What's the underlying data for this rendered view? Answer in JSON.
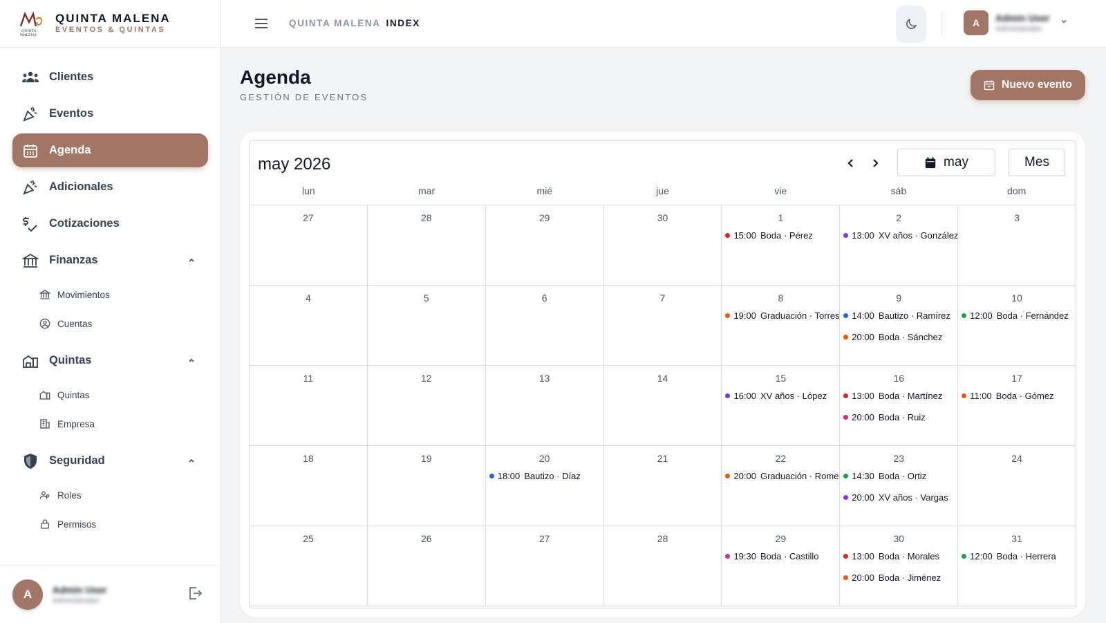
{
  "brand": {
    "title": "QUINTA MALENA",
    "subtitle": "EVENTOS & QUINTAS",
    "logo_text": "QUINTA MALENA"
  },
  "colors": {
    "accent": "#a27667",
    "event_red": "#dc2626",
    "event_purple": "#7c3aed",
    "event_orange": "#ea580c",
    "event_blue": "#2563eb",
    "event_green": "#16a34a",
    "event_pink": "#db2777"
  },
  "sidebar": {
    "items": [
      {
        "label": "Clientes",
        "icon": "users-icon"
      },
      {
        "label": "Eventos",
        "icon": "party-popper-icon"
      },
      {
        "label": "Agenda",
        "icon": "calendar-icon",
        "active": true
      },
      {
        "label": "Adicionales",
        "icon": "party-popper-icon"
      },
      {
        "label": "Cotizaciones",
        "icon": "money-check-icon"
      },
      {
        "label": "Finanzas",
        "icon": "bank-icon",
        "expanded": true
      },
      {
        "label": "Movimientos",
        "icon": "bank-small-icon"
      },
      {
        "label": "Cuentas",
        "icon": "user-circle-icon"
      },
      {
        "label": "Quintas",
        "icon": "buildings-icon",
        "expanded": true
      },
      {
        "label": "Quintas",
        "icon": "buildings-small-icon"
      },
      {
        "label": "Empresa",
        "icon": "office-icon"
      },
      {
        "label": "Seguridad",
        "icon": "shield-icon",
        "expanded": true
      },
      {
        "label": "Roles",
        "icon": "user-group-icon"
      },
      {
        "label": "Permisos",
        "icon": "lock-icon"
      }
    ]
  },
  "user": {
    "initial": "A",
    "name": "Admin User",
    "role": "Administrador"
  },
  "topbar": {
    "crumb_app": "QUINTA MALENA",
    "crumb_page": "INDEX"
  },
  "page": {
    "title": "Agenda",
    "subtitle": "GESTIÓN DE EVENTOS",
    "new_button": "Nuevo evento"
  },
  "calendar": {
    "title": "may 2026",
    "month_button": "may",
    "view_button": "Mes",
    "weekdays": [
      "lun",
      "mar",
      "mié",
      "jue",
      "vie",
      "sáb",
      "dom"
    ],
    "weeks": [
      [
        {
          "n": "27",
          "ev": []
        },
        {
          "n": "28",
          "ev": []
        },
        {
          "n": "29",
          "ev": []
        },
        {
          "n": "30",
          "ev": []
        },
        {
          "n": "1",
          "ev": [
            {
              "t": "15:00",
              "d": "Boda · Pérez",
              "c": "#dc2626"
            }
          ]
        },
        {
          "n": "2",
          "ev": [
            {
              "t": "13:00",
              "d": "XV años · González",
              "c": "#7c3aed"
            }
          ]
        },
        {
          "n": "3",
          "ev": []
        }
      ],
      [
        {
          "n": "4",
          "ev": []
        },
        {
          "n": "5",
          "ev": []
        },
        {
          "n": "6",
          "ev": []
        },
        {
          "n": "7",
          "ev": []
        },
        {
          "n": "8",
          "ev": [
            {
              "t": "19:00",
              "d": "Graduación · Torres",
              "c": "#ea580c"
            }
          ]
        },
        {
          "n": "9",
          "ev": [
            {
              "t": "14:00",
              "d": "Bautizo · Ramírez",
              "c": "#2563eb"
            },
            {
              "t": "20:00",
              "d": "Boda · Sánchez",
              "c": "#ea580c"
            }
          ]
        },
        {
          "n": "10",
          "ev": [
            {
              "t": "12:00",
              "d": "Boda · Fernández",
              "c": "#16a34a"
            }
          ]
        }
      ],
      [
        {
          "n": "11",
          "ev": []
        },
        {
          "n": "12",
          "ev": []
        },
        {
          "n": "13",
          "ev": []
        },
        {
          "n": "14",
          "ev": []
        },
        {
          "n": "15",
          "ev": [
            {
              "t": "16:00",
              "d": "XV años · López",
              "c": "#7c3aed"
            }
          ]
        },
        {
          "n": "16",
          "ev": [
            {
              "t": "13:00",
              "d": "Boda · Martínez",
              "c": "#dc2626"
            },
            {
              "t": "20:00",
              "d": "Boda · Ruiz",
              "c": "#db2777"
            }
          ]
        },
        {
          "n": "17",
          "ev": [
            {
              "t": "11:00",
              "d": "Boda · Gómez",
              "c": "#ea580c"
            }
          ]
        }
      ],
      [
        {
          "n": "18",
          "ev": []
        },
        {
          "n": "19",
          "ev": []
        },
        {
          "n": "20",
          "ev": [
            {
              "t": "18:00",
              "d": "Bautizo · Díaz",
              "c": "#2563eb"
            }
          ]
        },
        {
          "n": "21",
          "ev": []
        },
        {
          "n": "22",
          "ev": [
            {
              "t": "20:00",
              "d": "Graduación · Romero",
              "c": "#ea580c"
            }
          ]
        },
        {
          "n": "23",
          "ev": [
            {
              "t": "14:30",
              "d": "Boda · Ortiz",
              "c": "#16a34a"
            },
            {
              "t": "20:00",
              "d": "XV años · Vargas",
              "c": "#7c3aed"
            }
          ]
        },
        {
          "n": "24",
          "ev": []
        }
      ],
      [
        {
          "n": "25",
          "ev": []
        },
        {
          "n": "26",
          "ev": []
        },
        {
          "n": "27",
          "ev": []
        },
        {
          "n": "28",
          "ev": []
        },
        {
          "n": "29",
          "ev": [
            {
              "t": "19:30",
              "d": "Boda · Castillo",
              "c": "#db2777"
            }
          ]
        },
        {
          "n": "30",
          "ev": [
            {
              "t": "13:00",
              "d": "Boda · Morales",
              "c": "#dc2626"
            },
            {
              "t": "20:00",
              "d": "Boda · Jiménez",
              "c": "#ea580c"
            }
          ]
        },
        {
          "n": "31",
          "ev": [
            {
              "t": "12:00",
              "d": "Boda · Herrera",
              "c": "#16a34a"
            }
          ]
        }
      ]
    ]
  }
}
